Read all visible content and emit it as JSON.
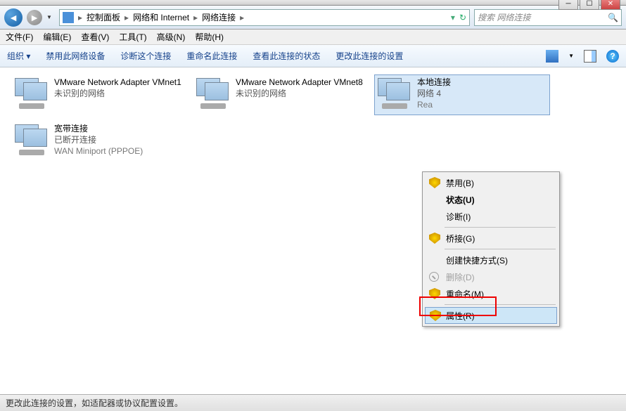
{
  "window_controls": {
    "min": "─",
    "max": "☐",
    "close": "✕"
  },
  "breadcrumb": {
    "seg1": "控制面板",
    "seg2": "网络和 Internet",
    "seg3": "网络连接"
  },
  "search": {
    "placeholder": "搜索 网络连接"
  },
  "menubar": {
    "file": "文件(F)",
    "edit": "编辑(E)",
    "view": "查看(V)",
    "tools": "工具(T)",
    "advanced": "高级(N)",
    "help": "帮助(H)"
  },
  "toolbar": {
    "organize": "组织 ▾",
    "disable": "禁用此网络设备",
    "diagnose": "诊断这个连接",
    "rename": "重命名此连接",
    "status": "查看此连接的状态",
    "settings": "更改此连接的设置",
    "help_glyph": "?"
  },
  "connections": [
    {
      "name": "VMware Network Adapter VMnet1",
      "sub": "未识别的网络",
      "sub2": ""
    },
    {
      "name": "VMware Network Adapter VMnet8",
      "sub": "未识别的网络",
      "sub2": ""
    },
    {
      "name": "本地连接",
      "sub": "网络  4",
      "sub2": "Rea"
    },
    {
      "name": "宽带连接",
      "sub": "已断开连接",
      "sub2": "WAN Miniport (PPPOE)"
    }
  ],
  "context_menu": {
    "disable": "禁用(B)",
    "status": "状态(U)",
    "diagnose": "诊断(I)",
    "bridge": "桥接(G)",
    "shortcut": "创建快捷方式(S)",
    "delete": "删除(D)",
    "rename": "重命名(M)",
    "properties": "属性(R)"
  },
  "statusbar": {
    "text": "更改此连接的设置，如适配器或协议配置设置。"
  }
}
